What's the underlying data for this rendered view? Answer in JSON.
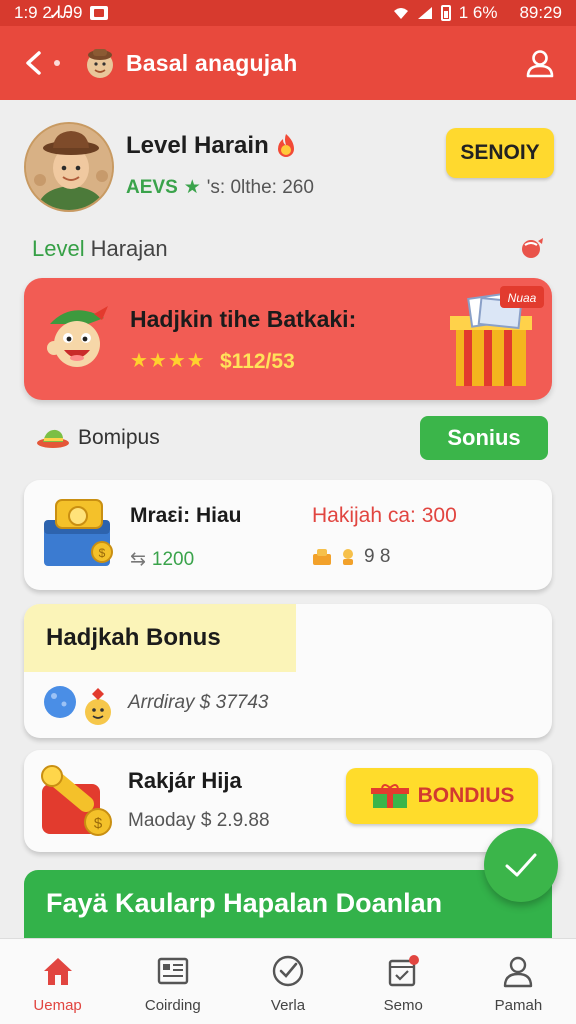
{
  "status_bar": {
    "time": "1:9 2ᏗᎯ9",
    "battery": "1 6%",
    "clock": "89:29"
  },
  "app_bar": {
    "title": "Basal anagujah"
  },
  "profile": {
    "name": "Level Harain",
    "tag": "AEVS",
    "meta": "'s: 0lthe: 260",
    "button_label": "SENOIY"
  },
  "level": {
    "green": "Level",
    "rest": "Harajan"
  },
  "promo": {
    "title": "Hadjkin tihe Batkaki:",
    "stars": "★★★★",
    "amount": "$112/53",
    "gift_tag": "Nuaa"
  },
  "bonus_section": {
    "label": "Bomipus",
    "button_label": "Sonius"
  },
  "card1": {
    "title": "Mraεi: Hiau",
    "value": "1200",
    "right_title": "Hakijah ca: 300",
    "counts": "9 8"
  },
  "card2": {
    "title": "Hadjkah Bonus",
    "subtitle": "Arrdiray $ 37743"
  },
  "card3": {
    "title": "Rakjár Hija",
    "subtitle": "Maoday $ 2.9.88",
    "chip_label": "BONDIUS"
  },
  "banner": {
    "text": "Fayä Kaularp Hapalan Doanlan"
  },
  "bottom_nav": [
    {
      "label": "Uemap",
      "icon": "home-icon",
      "active": true
    },
    {
      "label": "Coirding",
      "icon": "news-icon",
      "active": false
    },
    {
      "label": "Verla",
      "icon": "check-circle-icon",
      "active": false
    },
    {
      "label": "Semo",
      "icon": "calendar-icon",
      "active": false
    },
    {
      "label": "Pamah",
      "icon": "person-icon",
      "active": false
    }
  ],
  "colors": {
    "primary": "#e8493d",
    "accent_green": "#3bb54a",
    "accent_yellow": "#ffd92e"
  }
}
